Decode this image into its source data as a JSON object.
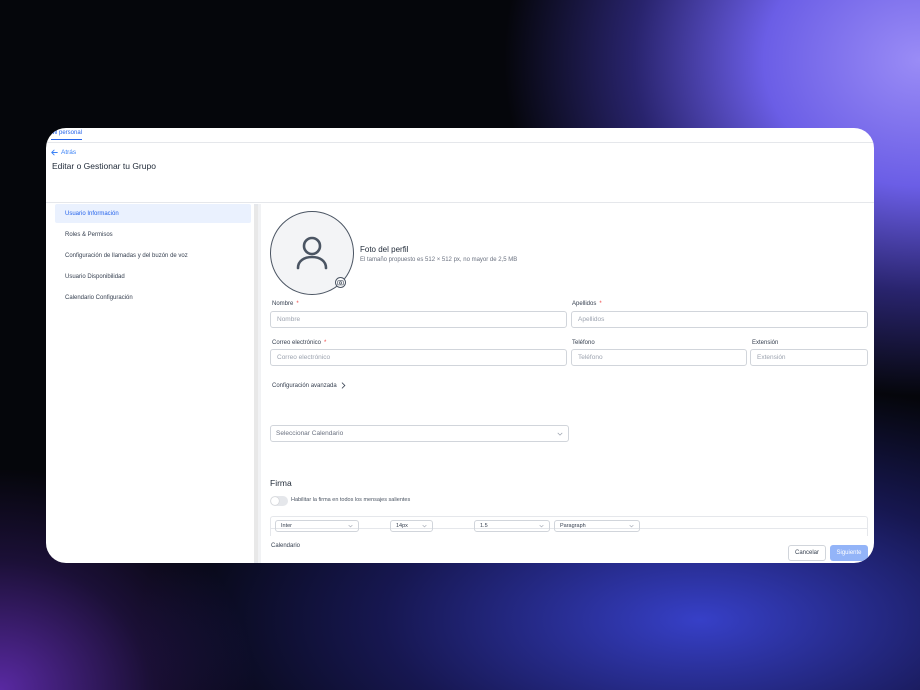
{
  "top_nav": {
    "tab_label": "Mi personal"
  },
  "header": {
    "back_label": "Atrás",
    "title": "Editar o Gestionar tu Grupo"
  },
  "sidebar": {
    "items": [
      {
        "label": "Usuario Información",
        "active": true
      },
      {
        "label": "Roles & Permisos"
      },
      {
        "label": "Configuración de llamadas y del buzón de voz"
      },
      {
        "label": "Usuario Disponibilidad"
      },
      {
        "label": "Calendario Configuración"
      }
    ]
  },
  "profile": {
    "photo_title": "Foto del perfil",
    "photo_description": "El tamaño propuesto es 512 × 512 px, no mayor de 2,5 MB"
  },
  "form": {
    "nombre": {
      "label": "Nombre",
      "required_mark": "*",
      "placeholder": "Nombre"
    },
    "apellidos": {
      "label": "Apellidos",
      "required_mark": "*",
      "placeholder": "Apellidos"
    },
    "correo": {
      "label": "Correo electrónico",
      "required_mark": "*",
      "placeholder": "Correo electrónico"
    },
    "telefono": {
      "label": "Teléfono",
      "placeholder": "Teléfono"
    },
    "extension": {
      "label": "Extensión",
      "placeholder": "Extensión"
    },
    "advanced_label": "Configuración avanzada",
    "calendario": {
      "label": "Calendario",
      "value": "Seleccionar Calendario"
    }
  },
  "firma": {
    "title": "Firma",
    "toggle_label": "Habilitar la firma en todos los mensajes salientes",
    "toolbar": {
      "font": "Inter",
      "size": "14px",
      "line_height": "1.5",
      "block": "Paragraph"
    }
  },
  "footer": {
    "cancel_label": "Cancelar",
    "next_label": "Siguiente"
  }
}
